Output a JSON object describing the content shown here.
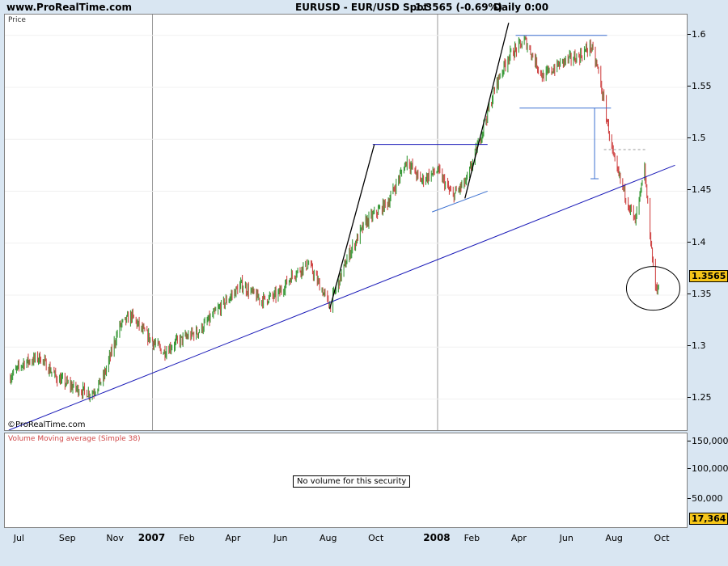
{
  "header": {
    "site": "www.ProRealTime.com",
    "symbol": "EURUSD - EUR/USD Spot",
    "price_change": "1.3565 (-0.69%)",
    "period": "Daily  0:00"
  },
  "price_panel": {
    "label": "Price",
    "copyright": "©ProRealTime.com",
    "last_price_label": "1.3565"
  },
  "volume_panel": {
    "label": "Volume Moving average (Simple 38)",
    "message": "No volume for this security",
    "last_value_label": "17,364",
    "y_ticks": [
      "150,000",
      "100,000",
      "50,000"
    ]
  },
  "colors": {
    "up_candle": "#3a9a3a",
    "down_candle": "#d04848",
    "trendline": "#1a1ab8",
    "channel": "#3a6fd0",
    "highlight": "#f5c518"
  },
  "chart_data": {
    "type": "candlestick",
    "instrument": "EURUSD",
    "y_ticks": [
      "1.6",
      "1.55",
      "1.5",
      "1.45",
      "1.4",
      "1.35",
      "1.3",
      "1.25"
    ],
    "ylim": [
      1.22,
      1.62
    ],
    "x_ticks": [
      "Jul",
      "Sep",
      "Nov",
      "2007",
      "Feb",
      "Apr",
      "Jun",
      "Aug",
      "Oct",
      "2008",
      "Feb",
      "Apr",
      "Jun",
      "Aug",
      "Oct"
    ],
    "grid": "vertical lines at year boundaries",
    "close_path": {
      "dates": [
        "2006-07-01",
        "2006-07-20",
        "2006-08-10",
        "2006-09-01",
        "2006-09-25",
        "2006-10-15",
        "2006-10-30",
        "2006-11-20",
        "2006-12-05",
        "2006-12-20",
        "2007-01-15",
        "2007-02-01",
        "2007-03-01",
        "2007-03-25",
        "2007-04-25",
        "2007-05-20",
        "2007-06-10",
        "2007-06-30",
        "2007-07-20",
        "2007-08-16",
        "2007-09-10",
        "2007-10-01",
        "2007-10-30",
        "2007-11-23",
        "2007-12-10",
        "2008-01-01",
        "2008-01-20",
        "2008-02-07",
        "2008-02-20",
        "2008-03-17",
        "2008-04-01",
        "2008-04-22",
        "2008-05-15",
        "2008-06-10",
        "2008-07-01",
        "2008-07-15",
        "2008-07-25",
        "2008-08-15",
        "2008-09-10",
        "2008-09-22",
        "2008-10-05",
        "2008-10-10"
      ],
      "values": [
        1.27,
        1.285,
        1.29,
        1.27,
        1.26,
        1.255,
        1.27,
        1.32,
        1.33,
        1.315,
        1.295,
        1.305,
        1.315,
        1.335,
        1.36,
        1.345,
        1.35,
        1.37,
        1.38,
        1.34,
        1.39,
        1.42,
        1.44,
        1.48,
        1.46,
        1.47,
        1.445,
        1.46,
        1.49,
        1.555,
        1.58,
        1.595,
        1.56,
        1.575,
        1.58,
        1.59,
        1.565,
        1.475,
        1.42,
        1.47,
        1.36,
        1.3565
      ]
    },
    "annotations": [
      {
        "type": "trendline",
        "from": [
          "2006-07-01",
          1.22
        ],
        "to": [
          "2008-10-31",
          1.475
        ]
      },
      {
        "type": "resistance",
        "from": [
          "2007-10-10",
          1.495
        ],
        "to": [
          "2008-03-05",
          1.495
        ]
      },
      {
        "type": "support",
        "from": [
          "2007-12-25",
          1.43
        ],
        "to": [
          "2008-03-05",
          1.45
        ]
      },
      {
        "type": "top",
        "from": [
          "2008-04-10",
          1.6
        ],
        "to": [
          "2008-08-05",
          1.6
        ]
      },
      {
        "type": "bottom",
        "from": [
          "2008-04-15",
          1.53
        ],
        "to": [
          "2008-08-10",
          1.53
        ]
      },
      {
        "type": "target",
        "date": "2008-07-20",
        "from": 1.53,
        "to": 1.462
      },
      {
        "type": "breakout",
        "from": [
          "2008-08-01",
          1.49
        ],
        "to": [
          "2008-09-25",
          1.49
        ]
      },
      {
        "type": "impulse",
        "from": [
          "2007-08-16",
          1.337
        ],
        "to": [
          "2007-10-12",
          1.495
        ]
      },
      {
        "type": "impulse",
        "from": [
          "2008-02-05",
          1.443
        ],
        "to": [
          "2008-04-01",
          1.612
        ]
      },
      {
        "type": "circle",
        "date": "2008-10-03",
        "value": 1.3565
      }
    ]
  }
}
